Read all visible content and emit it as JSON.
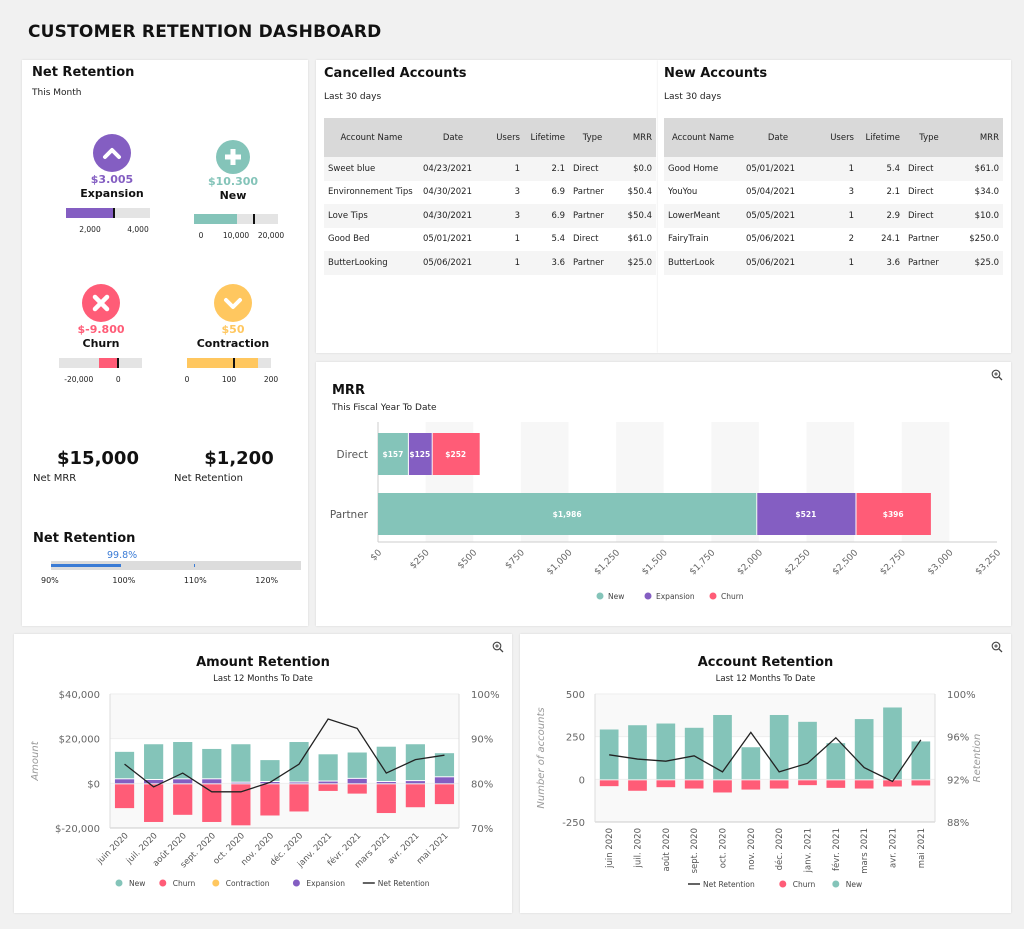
{
  "page": {
    "title": "CUSTOMER RETENTION DASHBOARD"
  },
  "colors": {
    "new": "#84c4b9",
    "expansion": "#845ec2",
    "churn": "#ff5c77",
    "contraction": "#ffc75f",
    "net_line": "#222222",
    "accent_blue": "#3a7bd5"
  },
  "net_retention_card": {
    "title": "Net Retention",
    "subtitle": "This Month",
    "kpis": [
      {
        "id": "expansion",
        "icon": "chevron-up-icon",
        "value": "$3.005",
        "label": "Expansion",
        "color": "#845ec2",
        "bullet": {
          "min": 1000,
          "max": 4500,
          "value": 3005,
          "marker": 3005,
          "ticks": [
            "2,000",
            "4,000"
          ],
          "tick_values": [
            2000,
            4000
          ]
        }
      },
      {
        "id": "new",
        "icon": "plus-icon",
        "value": "$10.300",
        "label": "New",
        "color": "#84c4b9",
        "bullet": {
          "min": -2000,
          "max": 22000,
          "value": 10300,
          "marker": 15000,
          "ticks": [
            "0",
            "10,000",
            "20,000"
          ],
          "tick_values": [
            0,
            10000,
            20000
          ]
        }
      },
      {
        "id": "churn",
        "icon": "x-icon",
        "value": "$-9.800",
        "label": "Churn",
        "color": "#ff5c77",
        "bullet": {
          "min": -30000,
          "max": 12000,
          "value": -9800,
          "from": -9800,
          "to": 0,
          "marker": 0,
          "ticks": [
            "-20,000",
            "0"
          ],
          "tick_values": [
            -20000,
            0
          ]
        }
      },
      {
        "id": "contraction",
        "icon": "chevron-down-icon",
        "value": "$50",
        "label": "Contraction",
        "color": "#ffc75f",
        "bullet": {
          "min": 0,
          "max": 200,
          "value": 170,
          "marker": 112,
          "ticks": [
            "0",
            "100",
            "200"
          ],
          "tick_values": [
            0,
            100,
            200
          ]
        }
      }
    ],
    "net_mrr": {
      "value": "$15,000",
      "label": "Net MRR"
    },
    "net_retention_total": {
      "value": "$1,200",
      "label": "Net Retention"
    },
    "gauge": {
      "title": "Net Retention",
      "value": 99.8,
      "value_label": "99.8%",
      "target": 110,
      "min": 90,
      "max": 125,
      "ticks": [
        "90%",
        "100%",
        "110%",
        "120%"
      ],
      "tick_values": [
        90,
        100,
        110,
        120
      ]
    }
  },
  "cancelled_accounts": {
    "title": "Cancelled Accounts",
    "subtitle": "Last 30 days",
    "columns": [
      "Account Name",
      "Date",
      "Users",
      "Lifetime",
      "Type",
      "MRR"
    ],
    "rows": [
      [
        "Sweet blue",
        "04/23/2021",
        "1",
        "2.1",
        "Direct",
        "$0.0"
      ],
      [
        "Environnement Tips",
        "04/30/2021",
        "3",
        "6.9",
        "Partner",
        "$50.4"
      ],
      [
        "Love Tips",
        "04/30/2021",
        "3",
        "6.9",
        "Partner",
        "$50.4"
      ],
      [
        "Good Bed",
        "05/01/2021",
        "1",
        "5.4",
        "Direct",
        "$61.0"
      ],
      [
        "ButterLooking",
        "05/06/2021",
        "1",
        "3.6",
        "Partner",
        "$25.0"
      ]
    ]
  },
  "new_accounts": {
    "title": "New Accounts",
    "subtitle": "Last 30 days",
    "columns": [
      "Account Name",
      "Date",
      "Users",
      "Lifetime",
      "Type",
      "MRR"
    ],
    "rows": [
      [
        "Good Home",
        "05/01/2021",
        "1",
        "5.4",
        "Direct",
        "$61.0"
      ],
      [
        "YouYou",
        "05/04/2021",
        "3",
        "2.1",
        "Direct",
        "$34.0"
      ],
      [
        "LowerMeant",
        "05/05/2021",
        "1",
        "2.9",
        "Direct",
        "$10.0"
      ],
      [
        "FairyTrain",
        "05/06/2021",
        "2",
        "24.1",
        "Partner",
        "$250.0"
      ],
      [
        "ButterLook",
        "05/06/2021",
        "1",
        "3.6",
        "Partner",
        "$25.0"
      ]
    ]
  },
  "chart_data": [
    {
      "id": "mrr",
      "type": "bar",
      "orientation": "horizontal",
      "stacked": true,
      "title": "MRR",
      "subtitle": "This Fiscal Year To Date",
      "categories": [
        "Direct",
        "Partner"
      ],
      "series": [
        {
          "name": "New",
          "values": [
            157,
            1986
          ],
          "labels": [
            "$157",
            "$1,986"
          ]
        },
        {
          "name": "Expansion",
          "values": [
            125,
            521
          ],
          "labels": [
            "$125",
            "$521"
          ]
        },
        {
          "name": "Churn",
          "values": [
            252,
            396
          ],
          "labels": [
            "$252",
            "$396"
          ]
        }
      ],
      "xlim": [
        0,
        3250
      ],
      "xticks": [
        "$0",
        "$250",
        "$500",
        "$750",
        "$1,000",
        "$1,250",
        "$1,500",
        "$1,750",
        "$2,000",
        "$2,250",
        "$2,500",
        "$2,750",
        "$3,000",
        "$3,250"
      ],
      "legend": [
        "New",
        "Expansion",
        "Churn"
      ],
      "legend_position": "bottom",
      "grid": true
    },
    {
      "id": "amount_retention",
      "type": "bar",
      "stacked": true,
      "title": "Amount Retention",
      "subtitle": "Last 12 Months To Date",
      "categories": [
        "juin 2020",
        "juil. 2020",
        "août 2020",
        "sept. 2020",
        "oct. 2020",
        "nov. 2020",
        "déc. 2020",
        "janv. 2021",
        "févr. 2021",
        "mars 2021",
        "avr. 2021",
        "mai 2021"
      ],
      "series": [
        {
          "name": "New",
          "values": [
            12300,
            16000,
            16700,
            13600,
            17200,
            9800,
            18100,
            12200,
            11800,
            15800,
            16500,
            10800
          ]
        },
        {
          "name": "Churn",
          "values": [
            -11100,
            -17300,
            -14100,
            -17300,
            -18800,
            -14400,
            -12600,
            -3400,
            -4600,
            -13300,
            -10700,
            -9300
          ]
        },
        {
          "name": "Contraction",
          "values": [
            0,
            0,
            0,
            0,
            0,
            0,
            0,
            0,
            0,
            0,
            0,
            0
          ]
        },
        {
          "name": "Expansion",
          "values": [
            1800,
            1500,
            1800,
            1800,
            300,
            600,
            400,
            800,
            2000,
            600,
            1000,
            2700
          ]
        },
        {
          "name": "Net Retention",
          "type": "line",
          "axis": "right",
          "values": [
            84.3,
            79.2,
            82.3,
            78.1,
            78.1,
            80.2,
            84.3,
            94.4,
            92.3,
            82.3,
            85.3,
            86.3
          ]
        }
      ],
      "ylabel": "Amount",
      "ylim": [
        -20000,
        40000
      ],
      "yticks": [
        "$-20,000",
        "$0",
        "$20,000",
        "$40,000"
      ],
      "y2lim": [
        70,
        100
      ],
      "y2ticks": [
        "70%",
        "80%",
        "90%",
        "100%"
      ],
      "legend": [
        "New",
        "Churn",
        "Contraction",
        "Expansion",
        "Net Retention"
      ],
      "legend_position": "bottom"
    },
    {
      "id": "account_retention",
      "type": "bar",
      "stacked": true,
      "title": "Account Retention",
      "subtitle": "Last 12 Months To Date",
      "categories": [
        "juin 2020",
        "juil. 2020",
        "août 2020",
        "sept. 2020",
        "oct. 2020",
        "nov. 2020",
        "déc. 2020",
        "janv. 2021",
        "févr. 2021",
        "mars 2021",
        "avr. 2021",
        "mai 2021"
      ],
      "series": [
        {
          "name": "Net Retention",
          "type": "line",
          "axis": "right",
          "values": [
            94.3,
            93.9,
            93.7,
            94.2,
            92.7,
            96.4,
            92.7,
            93.5,
            95.9,
            93.1,
            91.8,
            95.7
          ]
        },
        {
          "name": "Churn",
          "values": [
            -40,
            -67,
            -46,
            -54,
            -77,
            -60,
            -54,
            -34,
            -50,
            -54,
            -42,
            -36
          ]
        },
        {
          "name": "New",
          "values": [
            292,
            317,
            327,
            302,
            377,
            188,
            377,
            337,
            212,
            353,
            421,
            222
          ]
        }
      ],
      "ylabel": "Number of accounts",
      "ylim": [
        -250,
        500
      ],
      "yticks": [
        "-250",
        "0",
        "250",
        "500"
      ],
      "y2label": "Retention",
      "y2lim": [
        88,
        100
      ],
      "y2ticks": [
        "88%",
        "92%",
        "96%",
        "100%"
      ],
      "legend": [
        "Net Retention",
        "Churn",
        "New"
      ],
      "legend_position": "bottom"
    }
  ]
}
